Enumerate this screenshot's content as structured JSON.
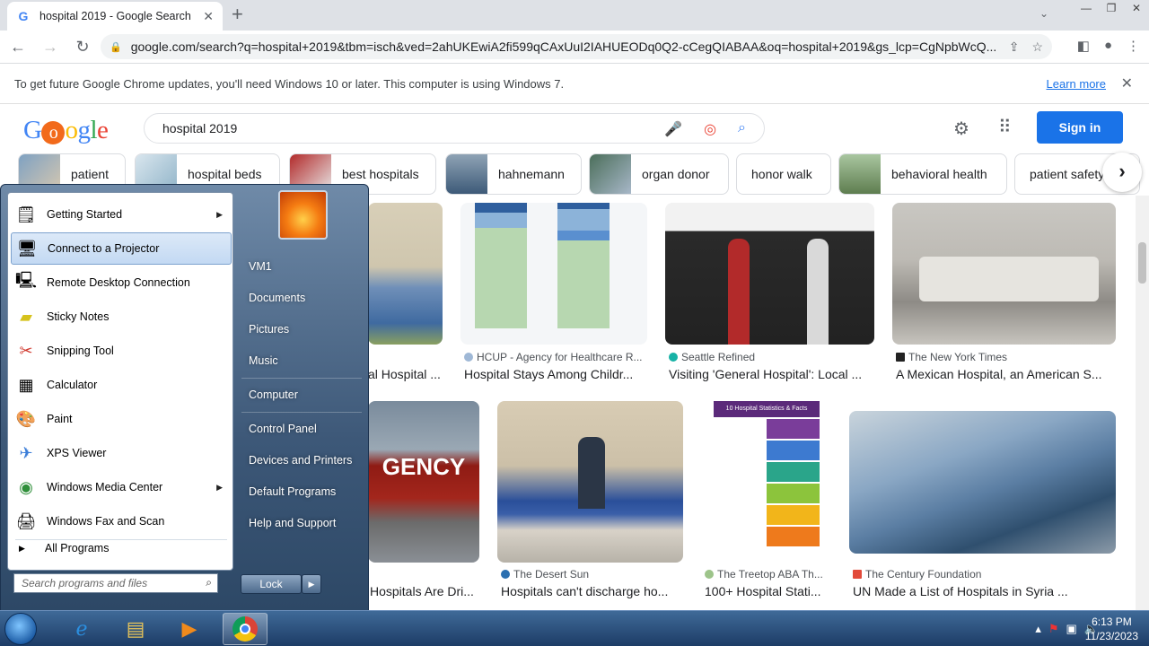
{
  "browser": {
    "tab_title": "hospital 2019 - Google Search",
    "url": "google.com/search?q=hospital+2019&tbm=isch&ved=2ahUKEwiA2fi599qCAxUuI2IAHUEODq0Q2-cCegQIABAA&oq=hospital+2019&gs_lcp=CgNpbWcQ..."
  },
  "infobar": {
    "message": "To get future Google Chrome updates, you'll need Windows 10 or later. This computer is using Windows 7.",
    "learn_more": "Learn more"
  },
  "google": {
    "query": "hospital 2019",
    "sign_in": "Sign in",
    "chips": [
      "patient",
      "hospital beds",
      "best hospitals",
      "hahnemann",
      "organ donor",
      "honor walk",
      "behavioral health",
      "patient safety"
    ]
  },
  "results": [
    {
      "source": "",
      "caption": "al Hospital ..."
    },
    {
      "source": "HCUP - Agency for Healthcare R...",
      "caption": "Hospital Stays Among Childr..."
    },
    {
      "source": "Seattle Refined",
      "caption": "Visiting 'General Hospital': Local ..."
    },
    {
      "source": "The New York Times",
      "caption": "A Mexican Hospital, an American S..."
    },
    {
      "source": "",
      "caption": "Hospitals Are Dri..."
    },
    {
      "source": "The Desert Sun",
      "caption": "Hospitals can't discharge ho..."
    },
    {
      "source": "The Treetop ABA Th...",
      "caption": "100+ Hospital Stati..."
    },
    {
      "source": "The Century Foundation",
      "caption": "UN Made a List of Hospitals in Syria ..."
    }
  ],
  "image_text": {
    "emergency_sign": "GENCY",
    "stats_title": "10 Hospital Statistics & Facts"
  },
  "start_menu": {
    "programs": [
      {
        "label": "Getting Started",
        "icon": "getting-started-icon",
        "submenu": true
      },
      {
        "label": "Connect to a Projector",
        "icon": "projector-icon",
        "submenu": false
      },
      {
        "label": "Remote Desktop Connection",
        "icon": "remote-desktop-icon",
        "submenu": false
      },
      {
        "label": "Sticky Notes",
        "icon": "sticky-notes-icon",
        "submenu": false
      },
      {
        "label": "Snipping Tool",
        "icon": "snipping-tool-icon",
        "submenu": false
      },
      {
        "label": "Calculator",
        "icon": "calculator-icon",
        "submenu": false
      },
      {
        "label": "Paint",
        "icon": "paint-icon",
        "submenu": false
      },
      {
        "label": "XPS Viewer",
        "icon": "xps-viewer-icon",
        "submenu": false
      },
      {
        "label": "Windows Media Center",
        "icon": "media-center-icon",
        "submenu": true
      },
      {
        "label": "Windows Fax and Scan",
        "icon": "fax-scan-icon",
        "submenu": false
      }
    ],
    "all_programs": "All Programs",
    "search_placeholder": "Search programs and files",
    "right_links": [
      "VM1",
      "Documents",
      "Pictures",
      "Music",
      "Computer",
      "Control Panel",
      "Devices and Printers",
      "Default Programs",
      "Help and Support"
    ],
    "lock": "Lock"
  },
  "taskbar": {
    "time": "6:13 PM",
    "date": "11/23/2023"
  }
}
